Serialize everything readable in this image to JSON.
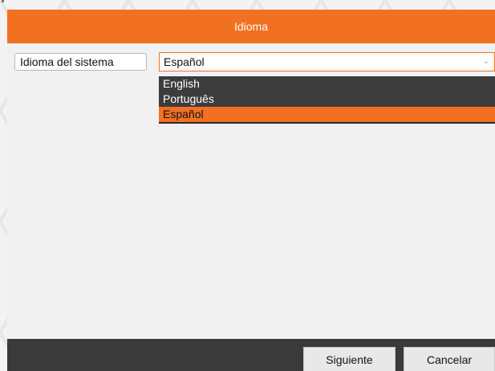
{
  "dialog": {
    "title": "Idioma"
  },
  "language_field": {
    "label": "Idioma del sistema",
    "selected_value": "Español"
  },
  "dropdown": {
    "options": [
      {
        "label": "English",
        "selected": false
      },
      {
        "label": "Português",
        "selected": false
      },
      {
        "label": "Español",
        "selected": true
      }
    ]
  },
  "footer": {
    "next_label": "Siguiente",
    "cancel_label": "Cancelar"
  },
  "colors": {
    "accent": "#f27022",
    "footer_bg": "#3a3a3a",
    "dropdown_bg": "#3c3c3c",
    "content_bg": "#f1f1f1"
  },
  "icons": {
    "dropdown_indicator": "chevron-down-icon"
  }
}
